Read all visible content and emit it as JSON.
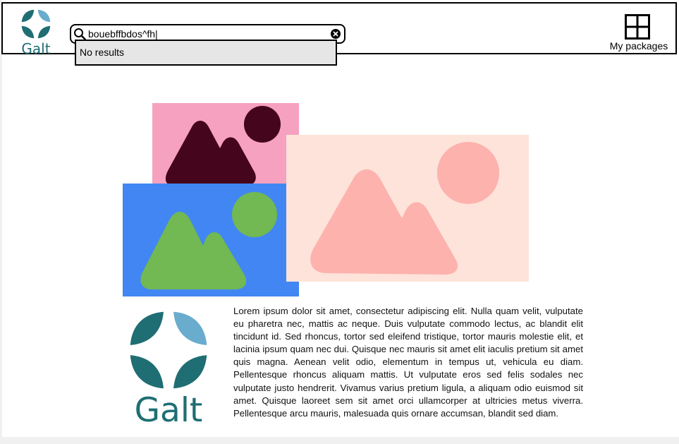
{
  "header": {
    "logo_text": "Galt",
    "search": {
      "value": "bouebffbdos^fh|"
    },
    "dropdown_message": "No results",
    "my_packages_label": "My packages"
  },
  "main": {
    "logo_text": "Galt",
    "paragraph": "Lorem ipsum dolor sit amet, consectetur adipiscing elit. Nulla quam velit, vulputate eu pharetra nec, mattis ac neque. Duis vulputate commodo lectus, ac blandit elit tincidunt id. Sed rhoncus, tortor sed eleifend tristique, tortor mauris molestie elit, et lacinia ipsum quam nec dui. Quisque nec mauris sit amet elit iaculis pretium sit amet quis magna. Aenean velit odio, elementum in tempus ut, vehicula eu diam. Pellentesque rhoncus aliquam mattis. Ut vulputate eros sed felis sodales nec vulputate justo hendrerit. Vivamus varius pretium ligula, a aliquam odio euismod sit amet. Quisque laoreet sem sit amet orci ullamcorper at ultricies metus viverra. Pellentesque arcu mauris, malesuada quis ornare accumsan, blandit sed diam."
  },
  "colors": {
    "brand_teal": "#1f6e73",
    "brand_light_blue": "#6aaccd",
    "image_pink_bg": "#f6a1bf",
    "image_pink_shape": "#45051c",
    "image_blue_bg": "#4186f3",
    "image_green_shape": "#72b853",
    "image_peach_bg": "#fde3d9",
    "image_salmon_shape": "#fdb2ae"
  },
  "icons": [
    "search-icon",
    "clear-icon",
    "grid-icon",
    "image-placeholder-icon"
  ]
}
